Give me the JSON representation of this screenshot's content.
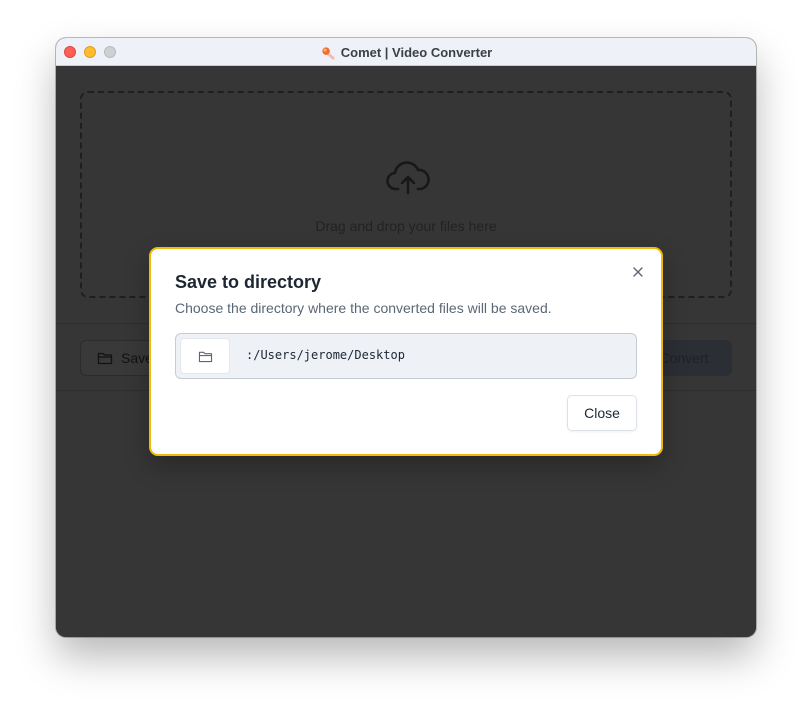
{
  "window": {
    "title": "Comet | Video Converter"
  },
  "dropzone": {
    "text": "Drag and drop your files here",
    "icon": "cloud-upload-icon"
  },
  "footer": {
    "save_label": "Save",
    "convert_label": "Convert"
  },
  "modal": {
    "title": "Save to directory",
    "description": "Choose the directory where the converted files will be saved.",
    "path": ":/Users/jerome/Desktop",
    "close_label": "Close",
    "accent_color": "#f2b90c"
  }
}
